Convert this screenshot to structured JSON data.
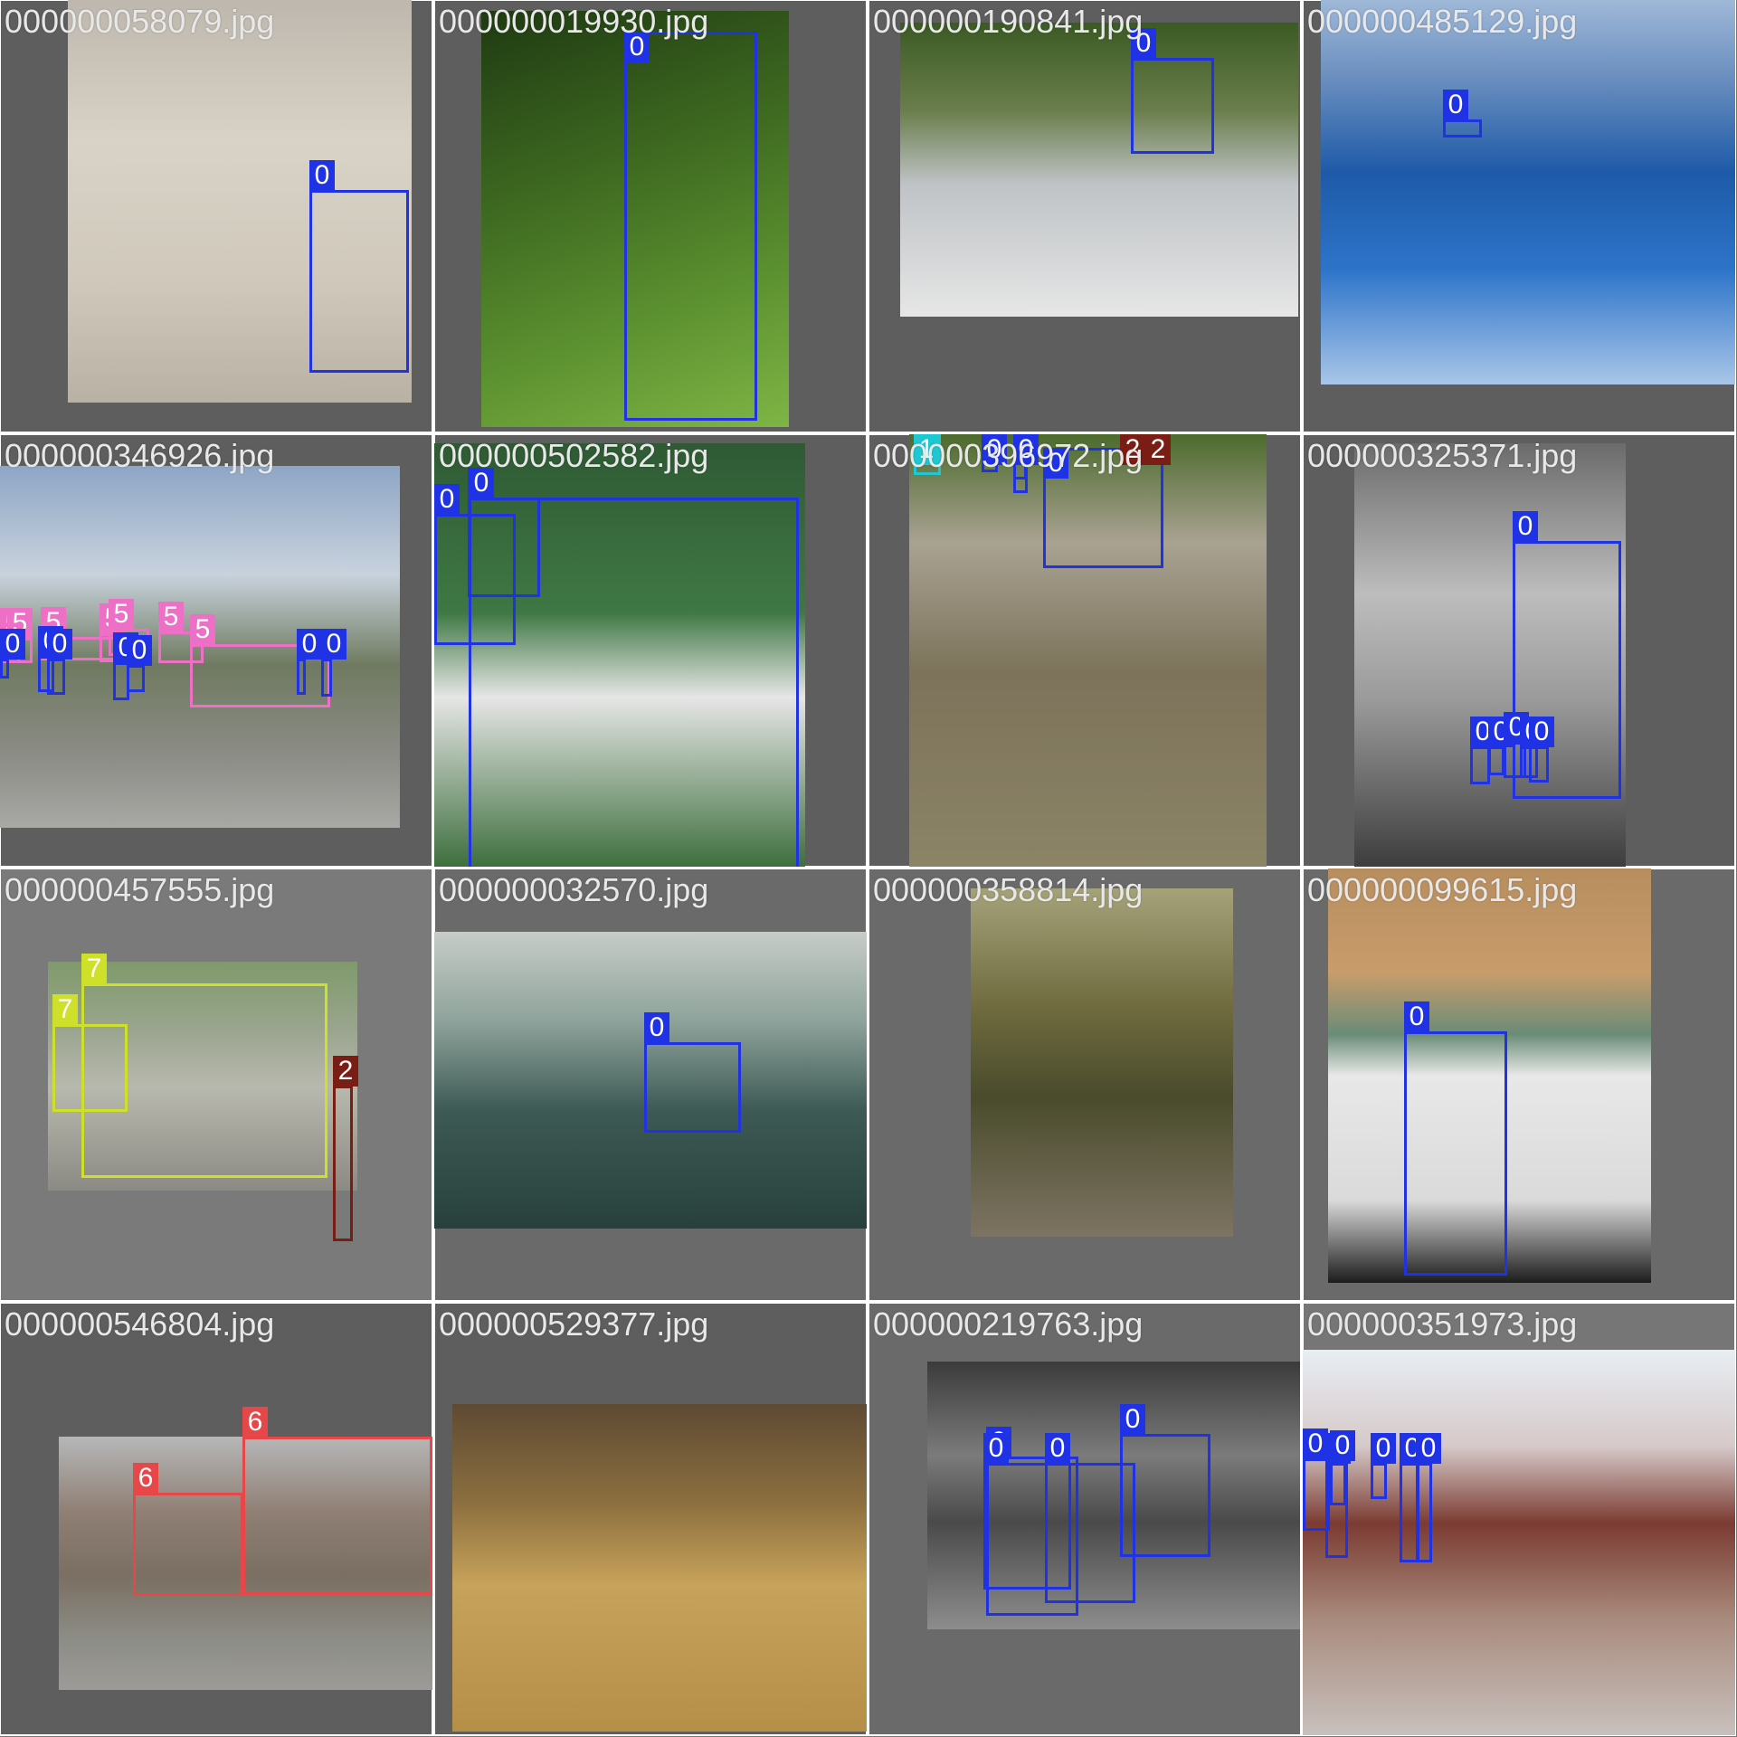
{
  "colors": {
    "cls0": "#1f32e6",
    "cls1": "#1ec8d2",
    "cls2": "#7a1d14",
    "cls5": "#ee6fc6",
    "cls6": "#e8474a",
    "cls7": "#cfe02a"
  },
  "tiles": [
    {
      "filename": "000000058079.jpg",
      "bg": "#5e5e5e",
      "photo_bg": "linear-gradient(180deg,#bdb7ad 0%,#d9d3c7 35%,#cfc8bb 70%,#b8b1a4 100%)",
      "boxes": [
        {
          "cls": "0"
        }
      ]
    },
    {
      "filename": "000000019930.jpg",
      "bg": "#5e5e5e",
      "photo_bg": "linear-gradient(160deg,#1f3a12 0%,#3f6b21 40%,#5c9130 70%,#7fb545 100%)",
      "boxes": [
        {
          "cls": "0"
        }
      ]
    },
    {
      "filename": "000000190841.jpg",
      "bg": "#5e5e5e",
      "photo_bg": "linear-gradient(180deg,#3b5a24 0%,#6a7e4c 30%,#bfc3c6 55%,#e6e6e6 100%)",
      "boxes": [
        {
          "cls": "0"
        }
      ]
    },
    {
      "filename": "000000485129.jpg",
      "bg": "#5e5e5e",
      "photo_bg": "linear-gradient(180deg,#9fb8d8 0%,#6b8fbf 20%,#1e5aa8 45%,#2d74c9 70%,#a9c6e8 100%)",
      "boxes": [
        {
          "cls": "0"
        }
      ]
    },
    {
      "filename": "000000346926.jpg",
      "bg": "#5e5e5e",
      "photo_bg": "linear-gradient(180deg,#8ea6c6 0%,#c8d2dd 30%,#6f7a60 55%,#8c8c87 80%,#a8a8a4 100%)",
      "boxes": [
        {
          "cls": "5"
        },
        {
          "cls": "5"
        },
        {
          "cls": "5"
        },
        {
          "cls": "5"
        },
        {
          "cls": "5"
        },
        {
          "cls": "5"
        },
        {
          "cls": "5"
        },
        {
          "cls": "0"
        },
        {
          "cls": "0"
        },
        {
          "cls": "0"
        },
        {
          "cls": "0"
        },
        {
          "cls": "0"
        },
        {
          "cls": "0"
        },
        {
          "cls": "0"
        }
      ]
    },
    {
      "filename": "000000502582.jpg",
      "bg": "#5e5e5e",
      "photo_bg": "linear-gradient(180deg,#2f5a34 0%,#3f7844 40%,#e6e6e6 60%,#3e6f3e 100%)",
      "boxes": [
        {
          "cls": "0"
        },
        {
          "cls": "0"
        },
        {
          "cls": "0"
        },
        {
          "cls": "0"
        }
      ]
    },
    {
      "filename": "000000396972.jpg",
      "bg": "#5e5e5e",
      "photo_bg": "linear-gradient(180deg,#4c6b2c 0%,#a9a292 25%,#7c735a 55%,#8c8466 100%)",
      "boxes": [
        {
          "cls": "1"
        },
        {
          "cls": "0"
        },
        {
          "cls": "0"
        },
        {
          "cls": "0"
        },
        {
          "cls": "0"
        },
        {
          "cls": "2"
        },
        {
          "cls": "2"
        }
      ]
    },
    {
      "filename": "000000325371.jpg",
      "bg": "#5e5e5e",
      "photo_bg": "linear-gradient(180deg,#6b6b6b 0%,#bdbdbd 35%,#9a9a9a 60%,#3a3a3a 100%)",
      "boxes": [
        {
          "cls": "0"
        },
        {
          "cls": "0"
        },
        {
          "cls": "0"
        },
        {
          "cls": "0"
        },
        {
          "cls": "0"
        },
        {
          "cls": "0"
        }
      ]
    },
    {
      "filename": "000000457555.jpg",
      "bg": "#7a7a7a",
      "photo_bg": "linear-gradient(180deg,#7f9a6a 0%,#9aa58f 30%,#b8b9ae 55%,#8b8a84 100%)",
      "boxes": [
        {
          "cls": "7"
        },
        {
          "cls": "7"
        },
        {
          "cls": "2"
        }
      ]
    },
    {
      "filename": "000000032570.jpg",
      "bg": "#6a6a6a",
      "photo_bg": "linear-gradient(180deg,#c7ccc7 0%,#8ea39b 30%,#3e5a55 60%,#27403c 100%)",
      "boxes": [
        {
          "cls": "0"
        }
      ]
    },
    {
      "filename": "000000358814.jpg",
      "bg": "#6a6a6a",
      "photo_bg": "linear-gradient(180deg,#a5a27a 0%,#6e6a3e 35%,#4a4b2c 60%,#7d7463 100%)",
      "boxes": []
    },
    {
      "filename": "000000099615.jpg",
      "bg": "#6a6a6a",
      "photo_bg": "linear-gradient(180deg,#b78e5f 0%,#c99c6b 25%,#6a8c77 40%,#e8e8e8 50%,#dadada 80%,#1c1c1c 100%)",
      "boxes": [
        {
          "cls": "0"
        }
      ]
    },
    {
      "filename": "000000546804.jpg",
      "bg": "#5e5e5e",
      "photo_bg": "linear-gradient(180deg,#b6b7b8 0%,#8f7f74 30%,#7a6f62 55%,#8d8d87 80%,#9c9b97 100%)",
      "boxes": [
        {
          "cls": "6"
        },
        {
          "cls": "6"
        }
      ]
    },
    {
      "filename": "000000529377.jpg",
      "bg": "#5e5e5e",
      "photo_bg": "linear-gradient(180deg,#5e4a33 0%,#8c6f3f 30%,#c7a25a 55%,#b58f47 100%)",
      "boxes": []
    },
    {
      "filename": "000000219763.jpg",
      "bg": "#6a6a6a",
      "photo_bg": "linear-gradient(180deg,#3b3b3b 0%,#7b7b7b 35%,#4a4a4a 60%,#8d8d8d 100%)",
      "boxes": [
        {
          "cls": "0"
        },
        {
          "cls": "0"
        },
        {
          "cls": "0"
        },
        {
          "cls": "0"
        }
      ]
    },
    {
      "filename": "000000351973.jpg",
      "bg": "#767676",
      "photo_bg": "linear-gradient(180deg,#e8eef3 0%,#d6c9c9 25%,#7b3b32 45%,#a98b7d 70%,#c8c0bd 100%)",
      "boxes": [
        {
          "cls": "0"
        },
        {
          "cls": "0"
        },
        {
          "cls": "0"
        },
        {
          "cls": "0"
        },
        {
          "cls": "0"
        },
        {
          "cls": "0"
        }
      ]
    }
  ]
}
